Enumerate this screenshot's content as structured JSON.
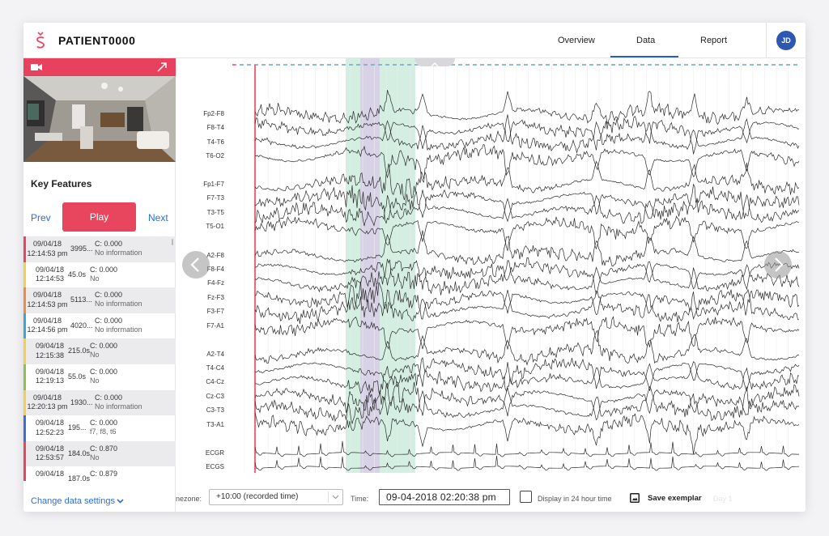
{
  "header": {
    "patient_name": "PATIENT0000",
    "tabs": [
      {
        "label": "Overview"
      },
      {
        "label": "Data"
      },
      {
        "label": "Report"
      }
    ],
    "active_tab": "Data",
    "user_initials": "JD"
  },
  "sidebar": {
    "key_features_title": "Key Features",
    "prev_label": "Prev",
    "play_label": "Play",
    "next_label": "Next",
    "change_settings_label": "Change data settings",
    "events": [
      {
        "date": "09/04/18",
        "time": "12:14:53 pm",
        "duration": "3995...",
        "c": "C: 0.000",
        "info": "No information",
        "marker": "#e8455f"
      },
      {
        "date": "09/04/18",
        "time": "12:14:53",
        "duration": "45.0s",
        "c": "C: 0.000",
        "info": "No",
        "marker": "#f3cf4a"
      },
      {
        "date": "09/04/18",
        "time": "12:14:53 pm",
        "duration": "5113...",
        "c": "C: 0.000",
        "info": "No information",
        "marker": "#f08a3c"
      },
      {
        "date": "09/04/18",
        "time": "12:14:56 pm",
        "duration": "4020...",
        "c": "C: 0.000",
        "info": "No information",
        "marker": "#3aa6d8"
      },
      {
        "date": "09/04/18",
        "time": "12:15:38",
        "duration": "215.0s",
        "c": "C: 0.000",
        "info": "No",
        "marker": "#f3cf4a"
      },
      {
        "date": "09/04/18",
        "time": "12:19:13",
        "duration": "55.0s",
        "c": "C: 0.000",
        "info": "No",
        "marker": "#8cc152"
      },
      {
        "date": "09/04/18",
        "time": "12:20:13 pm",
        "duration": "1930...",
        "c": "C: 0.000",
        "info": "No information",
        "marker": "#f3cf4a"
      },
      {
        "date": "09/04/18",
        "time": "12:52:23",
        "duration": "195...",
        "c": "C: 0.000",
        "info": "f7, f8, t6",
        "marker": "#3a6fd8"
      },
      {
        "date": "09/04/18",
        "time": "12:53:57",
        "duration": "184.0s",
        "c": "C: 0.870",
        "info": "No",
        "marker": "#e8455f"
      },
      {
        "date": "09/04/18",
        "time": "",
        "duration": "187.0s",
        "c": "C: 0.879",
        "info": "",
        "marker": "#e8455f"
      }
    ]
  },
  "eeg": {
    "channels": [
      "Fp2-F8",
      "F8-T4",
      "T4-T6",
      "T6-O2",
      "Fp1-F7",
      "F7-T3",
      "T3-T5",
      "T5-O1",
      "A2-F8",
      "F8-F4",
      "F4-Fz",
      "Fz-F3",
      "F3-F7",
      "F7-A1",
      "A2-T4",
      "T4-C4",
      "C4-Cz",
      "Cz-C3",
      "C3-T3",
      "T3-A1",
      "ECGR",
      "ECGS"
    ],
    "highlight_colors": {
      "green": "#d4efe1",
      "purple": "#d8d2e6"
    },
    "cursor_color": "#e8455f"
  },
  "toolbar": {
    "timezone_label": "nezone:",
    "timezone_value": "+10:00 (recorded time)",
    "time_label": "Time:",
    "time_value": "09-04-2018 02:20:38 pm",
    "display_24h_label": "Display in 24 hour time",
    "save_exemplar_label": "Save exemplar",
    "day_label": "Day 1"
  }
}
